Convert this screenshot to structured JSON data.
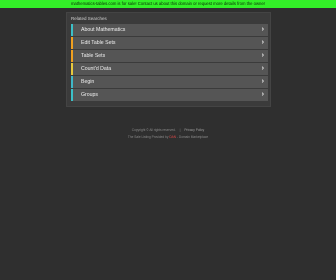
{
  "banner": {
    "text": "mathematics-tables.com is for sale! Contact us about this domain or request more details from the owner"
  },
  "panel": {
    "header": "Related Searches"
  },
  "menu": {
    "items": [
      {
        "label": "About Mathematics",
        "accent": "#3cc0c8"
      },
      {
        "label": "Edit Table Sets",
        "accent": "#f0a020"
      },
      {
        "label": "Table Sets",
        "accent": "#f0a020"
      },
      {
        "label": "Count'd Data",
        "accent": "#e8c83c"
      },
      {
        "label": "Begin",
        "accent": "#40b8c8"
      },
      {
        "label": "Groups",
        "accent": "#3cc0c8"
      }
    ],
    "chevron": "›"
  },
  "footer": {
    "line1_copyright": "Copyright © All rights reserved.",
    "line1_privacy": "Privacy Policy",
    "line2_prefix": "The Sale Listing Provided by",
    "line2_highlight": "DAN",
    "line2_suffix": "- Domain Marketplace"
  },
  "colors": {
    "banner_bg": "#33f028",
    "page_bg": "#2f2f2f",
    "panel_bg": "#3b3b3b",
    "item_bg": "#555555"
  }
}
